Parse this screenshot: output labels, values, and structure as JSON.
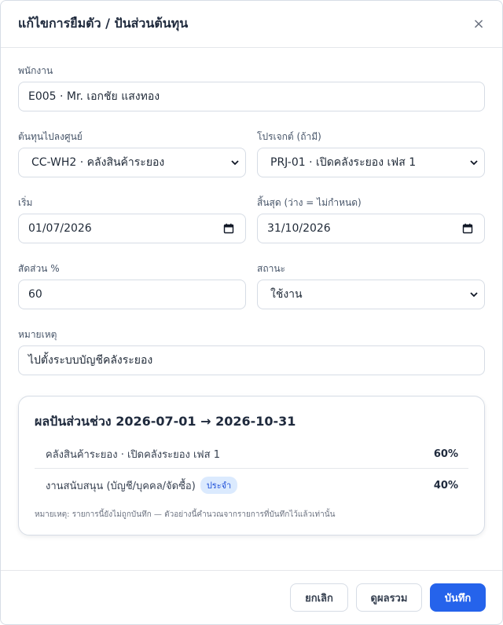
{
  "dialog": {
    "title": "แก้ไขการยืมตัว / ปันส่วนต้นทุน",
    "close_glyph": "×"
  },
  "form": {
    "employee": {
      "label": "พนักงาน",
      "value": "E005 · Mr. เอกชัย แสงทอง"
    },
    "cost_center": {
      "label": "ต้นทุนไปลงศูนย์",
      "value": "CC-WH2 · คลังสินค้าระยอง"
    },
    "project": {
      "label": "โปรเจกต์ (ถ้ามี)",
      "value": "PRJ-01 · เปิดคลังระยอง เฟส 1"
    },
    "start": {
      "label": "เริ่ม",
      "value": "01/07/2026"
    },
    "end": {
      "label": "สิ้นสุด (ว่าง = ไม่กำหนด)",
      "value": "31/10/2026"
    },
    "ratio": {
      "label": "สัดส่วน %",
      "value": "60"
    },
    "status": {
      "label": "สถานะ",
      "value": "ใช้งาน"
    },
    "remark": {
      "label": "หมายเหตุ",
      "value": "ไปตั้งระบบบัญชีคลังระยอง"
    }
  },
  "summary": {
    "title": "ผลปันส่วนช่วง 2026-07-01 → 2026-10-31",
    "rows": [
      {
        "name": "คลังสินค้าระยอง · เปิดคลังระยอง เฟส 1",
        "pct": "60%",
        "badge": ""
      },
      {
        "name": "งานสนับสนุน (บัญชี/บุคคล/จัดซื้อ)",
        "pct": "40%",
        "badge": "ประจำ"
      }
    ],
    "note": "หมายเหตุ: รายการนี้ยังไม่ถูกบันทึก — ตัวอย่างนี้คำนวณจากรายการที่บันทึกไว้แล้วเท่านั้น"
  },
  "footer": {
    "cancel": "ยกเลิก",
    "overview": "ดูผลรวม",
    "save": "บันทึก"
  },
  "colors": {
    "primary": "#2563eb",
    "badge_bg": "#dbeafe",
    "badge_text": "#1d4ed8"
  },
  "icons": {
    "close": "close-icon",
    "dropdown": "chevron-down-icon",
    "calendar": "calendar-icon"
  }
}
